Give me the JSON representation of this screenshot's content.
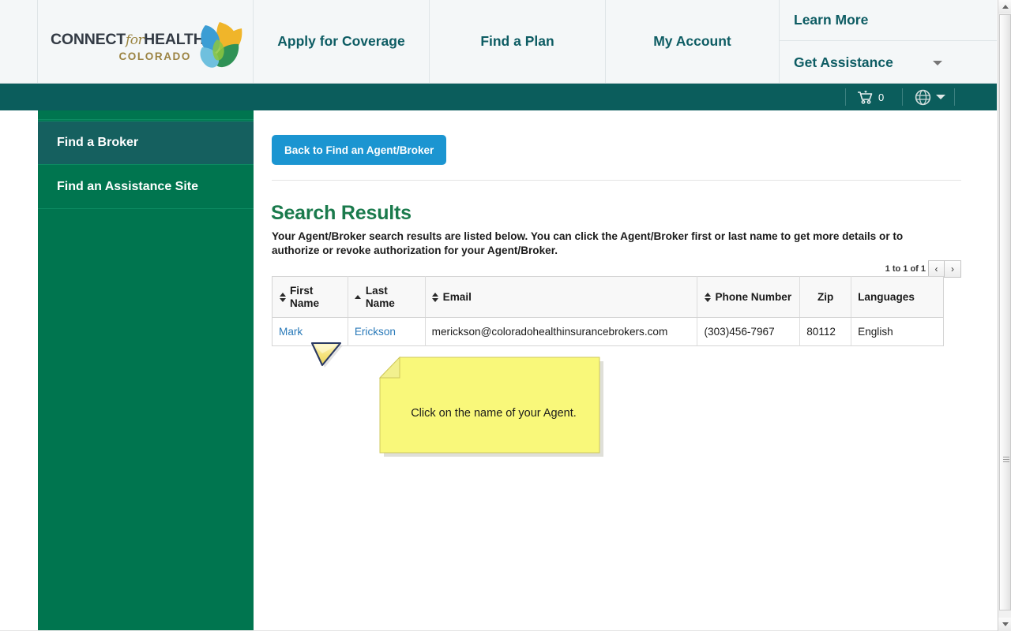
{
  "header": {
    "logo": {
      "main_line": "CONNECT",
      "script_word": "for",
      "main_line2": "HEALTH",
      "sub_line": "COLORADO",
      "mark_icon": "leaf-logo-icon"
    },
    "nav": [
      {
        "label": "Apply for Coverage",
        "name": "nav-apply-for-coverage"
      },
      {
        "label": "Find a Plan",
        "name": "nav-find-a-plan"
      },
      {
        "label": "My Account",
        "name": "nav-my-account"
      }
    ],
    "nav_stack": [
      {
        "label": "Learn More",
        "name": "nav-learn-more",
        "has_caret": false
      },
      {
        "label": "Get Assistance",
        "name": "nav-get-assistance",
        "has_caret": true
      }
    ]
  },
  "utility_bar": {
    "cart_icon": "shopping-cart-icon",
    "cart_count": "0",
    "globe_icon": "globe-icon",
    "language_caret_icon": "chevron-down-icon",
    "background_color": "#0b5d5c"
  },
  "sidebar": {
    "background_color": "#00754f",
    "active_color": "#15605f",
    "items": [
      {
        "label": "Find a Broker",
        "active": true
      },
      {
        "label": "Find an Assistance Site",
        "active": false
      }
    ]
  },
  "main": {
    "back_button": "Back to Find an Agent/Broker",
    "back_button_color": "#1b95d1",
    "heading": "Search Results",
    "heading_color": "#1a7a4c",
    "intro": "Your Agent/Broker search results are listed below. You can click the Agent/Broker first or last name to get more details or to authorize or revoke authorization for your Agent/Broker.",
    "pagination": {
      "range_label": "1 to 1 of 1",
      "prev_icon": "chevron-left-icon",
      "prev_glyph": "‹",
      "next_icon": "chevron-right-icon",
      "next_glyph": "›"
    },
    "table": {
      "columns": [
        {
          "label": "First Name",
          "sort": "both"
        },
        {
          "label": "Last Name",
          "sort": "asc"
        },
        {
          "label": "Email",
          "sort": "both"
        },
        {
          "label": "Phone Number",
          "sort": "both"
        },
        {
          "label": "Zip",
          "sort": "none"
        },
        {
          "label": "Languages",
          "sort": "none"
        }
      ],
      "rows": [
        {
          "first_name": "Mark",
          "last_name": "Erickson",
          "email": "merickson@coloradohealthinsurancebrokers.com",
          "phone": "(303)456-7967",
          "zip": "80112",
          "languages": "English"
        }
      ]
    }
  },
  "annotation": {
    "note_text": "Click on the name of your Agent.",
    "note_color": "#f9f87a",
    "cursor_icon": "arrow-cursor-down-icon"
  },
  "scrollbar": {
    "up_icon": "scroll-up-arrow-icon",
    "down_icon": "scroll-down-arrow-icon",
    "thumb_name": "scrollbar-thumb"
  }
}
